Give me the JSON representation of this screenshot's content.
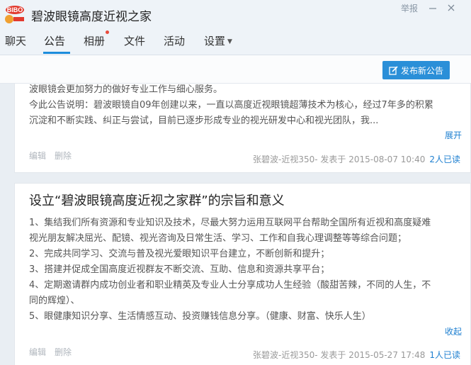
{
  "group": {
    "name": "碧波眼镜高度近视之家"
  },
  "header": {
    "report_label": "举报"
  },
  "tabs": [
    {
      "label": "聊天"
    },
    {
      "label": "公告"
    },
    {
      "label": "相册"
    },
    {
      "label": "文件"
    },
    {
      "label": "活动"
    },
    {
      "label": "设置"
    }
  ],
  "toolbar": {
    "publish_label": "发布新公告"
  },
  "announcements": [
    {
      "lines": [
        "波眼镜会更加努力的做好专业工作与细心服务。",
        "今此公告说明：碧波眼镜自09年创建以来，一直以高度近视眼镜超薄技术为核心，经过7年多的积累",
        "沉淀和不断实践、纠正与尝试，目前已逐步形成专业的视光研发中心和视光团队，我..."
      ],
      "toggle": "展开",
      "edit": "编辑",
      "delete": "删除",
      "meta": "张碧波-近视350- 发表于 2015-08-07 10:40",
      "reads": "2人已读"
    },
    {
      "title": "设立“碧波眼镜高度近视之家群”的宗旨和意义",
      "lines": [
        "1、集结我们所有资源和专业知识及技术，尽最大努力运用互联网平台帮助全国所有近视和高度疑难",
        "视光朋友解决屈光、配镜、视光咨询及日常生活、学习、工作和自我心理调整等等综合问题；",
        "2、完成共同学习、交流与普及视光爱眼知识平台建立，不断创新和提升；",
        "3、搭建并促成全国高度近视群友不断交流、互助、信息和资源共享平台；",
        "4、定期邀请群内成功创业者和职业精英及专业人士分享成功人生经验（酸甜苦辣，不同的人生，不",
        "同的辉煌）、",
        "5、眼健康知识分享、生活情感互动、投资赚钱信息分享。（健康、财富、快乐人生）"
      ],
      "toggle": "收起",
      "edit": "编辑",
      "delete": "删除",
      "meta": "张碧波-近视350- 发表于 2015-05-27 17:48",
      "reads": "1人已读"
    }
  ],
  "colors": {
    "accent": "#2a8fd8",
    "link": "#1d7fd0",
    "header_bg": "#eef3f8",
    "page_bg": "#e9eef3"
  },
  "icons": [
    "group-logo-icon",
    "minimize-icon",
    "close-icon",
    "chevron-down-icon",
    "edit-icon",
    "notification-dot"
  ]
}
